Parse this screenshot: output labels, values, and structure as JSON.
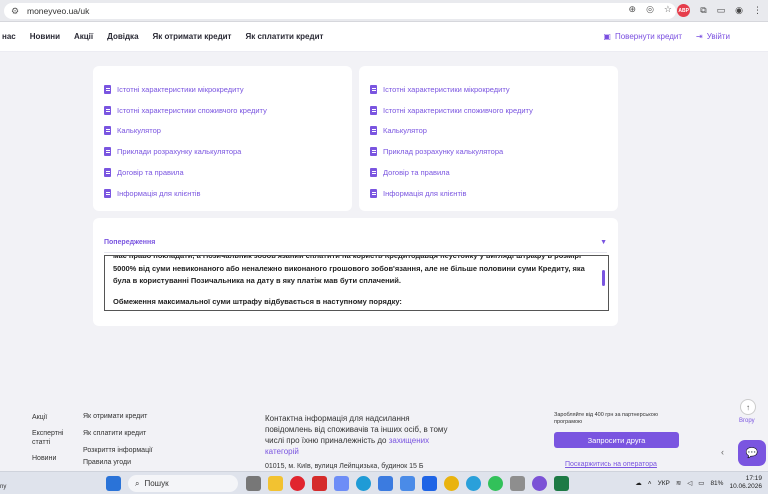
{
  "browser": {
    "url": "moneyveo.ua/uk",
    "extension_badge": "ABP"
  },
  "nav": {
    "items": [
      "нас",
      "Новини",
      "Акції",
      "Довідка",
      "Як отримати кредит",
      "Як сплатити кредит"
    ],
    "return_credit": "Повернути кредит",
    "login": "Увійти"
  },
  "left_card": {
    "links": [
      "Істотні характеристики мікрокредиту",
      "Істотні характеристики споживчого кредиту",
      "Калькулятор",
      "Приклади розрахунку калькулятора",
      "Договір та правила",
      "Інформація для клієнтів"
    ]
  },
  "right_card": {
    "links": [
      "Істотні характеристики мікрокредиту",
      "Істотні характеристики споживчого кредиту",
      "Калькулятор",
      "Приклад розрахунку калькулятора",
      "Договір та правила",
      "Інформація для клієнтів"
    ]
  },
  "warning": {
    "title": "Попередження",
    "paragraph1": "має право покладати, а Позичальник зобов'язаний сплатити на користь Кредитодавця неустойку у вигляді штрафу в розмірі 5000% від суми невиконаного або неналежно виконаного грошового зобов'язання, але не більше половини суми Кредиту, яка була в користуванні Позичальника на дату в яку платіж мав бути сплачений.",
    "paragraph2": "Обмеження максимальної суми штрафу відбувається в наступному порядку:"
  },
  "footer": {
    "col1": [
      "Акції",
      "Експертні статті",
      "Новини"
    ],
    "col2": [
      "Як отримати кредит",
      "Як сплатити кредит",
      "Розкриття інформації",
      "Правила угоди"
    ],
    "contact_text": "Контактна інформація для надсилання повідомлень від споживачів та інших осіб, в тому числі про їхню приналежність до ",
    "contact_link": "захищених категорій",
    "address": "01015, м. Київ, вулиця Лейпцизька, будинок 15 Б",
    "promo": "Заробляйте від 400 грн за партнерською програмою",
    "invite_button": "Запросити друга",
    "complain_link": "Поскаржитись на оператора",
    "up_label": "Вгору"
  },
  "taskbar": {
    "left_text": "ny",
    "search": "Пошук",
    "lang": "УКР",
    "battery": "81%",
    "time": "17:19",
    "date": "10.06.2026"
  }
}
